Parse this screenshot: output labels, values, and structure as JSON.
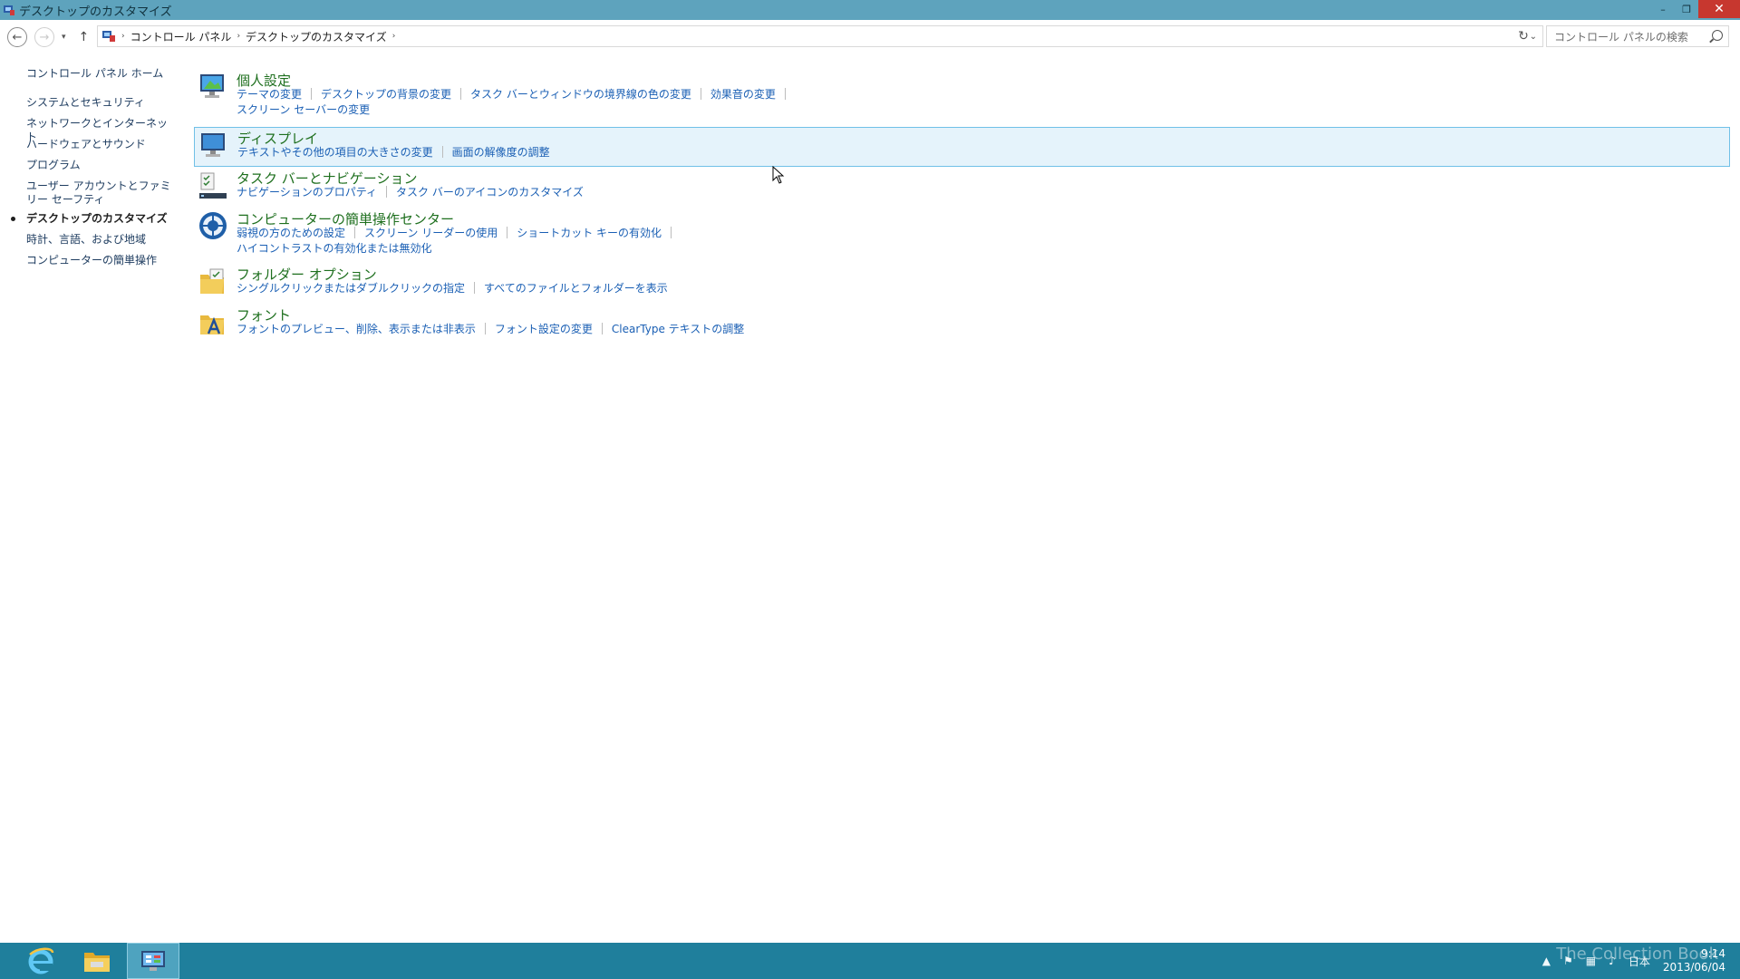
{
  "window": {
    "title": "デスクトップのカスタマイズ",
    "minimize_glyph": "–",
    "restore_glyph": "❐",
    "close_glyph": "✕"
  },
  "navbar": {
    "back_glyph": "←",
    "forward_glyph": "→",
    "recent_glyph": "▾",
    "up_glyph": "↑",
    "breadcrumbs": [
      "コントロール パネル",
      "デスクトップのカスタマイズ"
    ],
    "crumb_sep": "›",
    "dropdown_glyph": "⌄",
    "refresh_glyph": "↻",
    "search_placeholder": "コントロール パネルの検索"
  },
  "sidebar": {
    "items": [
      {
        "label": "コントロール パネル ホーム"
      },
      {
        "label": "システムとセキュリティ"
      },
      {
        "label": "ネットワークとインターネット"
      },
      {
        "label": "ハードウェアとサウンド"
      },
      {
        "label": "プログラム"
      },
      {
        "label": "ユーザー アカウントとファミリー セーフティ"
      },
      {
        "label": "デスクトップのカスタマイズ"
      },
      {
        "label": "時計、言語、および地域"
      },
      {
        "label": "コンピューターの簡単操作"
      }
    ]
  },
  "categories": [
    {
      "title": "個人設定",
      "links": [
        "テーマの変更",
        "デスクトップの背景の変更",
        "タスク バーとウィンドウの境界線の色の変更",
        "効果音の変更",
        "スクリーン セーバーの変更"
      ]
    },
    {
      "title": "ディスプレイ",
      "links": [
        "テキストやその他の項目の大きさの変更",
        "画面の解像度の調整"
      ]
    },
    {
      "title": "タスク バーとナビゲーション",
      "links": [
        "ナビゲーションのプロパティ",
        "タスク バーのアイコンのカスタマイズ"
      ]
    },
    {
      "title": "コンピューターの簡単操作センター",
      "links": [
        "弱視の方のための設定",
        "スクリーン リーダーの使用",
        "ショートカット キーの有効化",
        "ハイコントラストの有効化または無効化"
      ]
    },
    {
      "title": "フォルダー オプション",
      "links": [
        "シングルクリックまたはダブルクリックの指定",
        "すべてのファイルとフォルダーを表示"
      ]
    },
    {
      "title": "フォント",
      "links": [
        "フォントのプレビュー、削除、表示または非表示",
        "フォント設定の変更",
        "ClearType テキストの調整"
      ]
    }
  ],
  "tray": {
    "language": "日本",
    "time": "9:14",
    "date": "2013/06/04",
    "watermark": "The Collection Book"
  },
  "colors": {
    "titlebar": "#5ea3bd",
    "taskbar": "#1f7f9c",
    "link": "#1a5fb4",
    "category_title": "#1e6f1e",
    "highlight_bg": "#e5f3fb",
    "highlight_border": "#70c0e7"
  }
}
